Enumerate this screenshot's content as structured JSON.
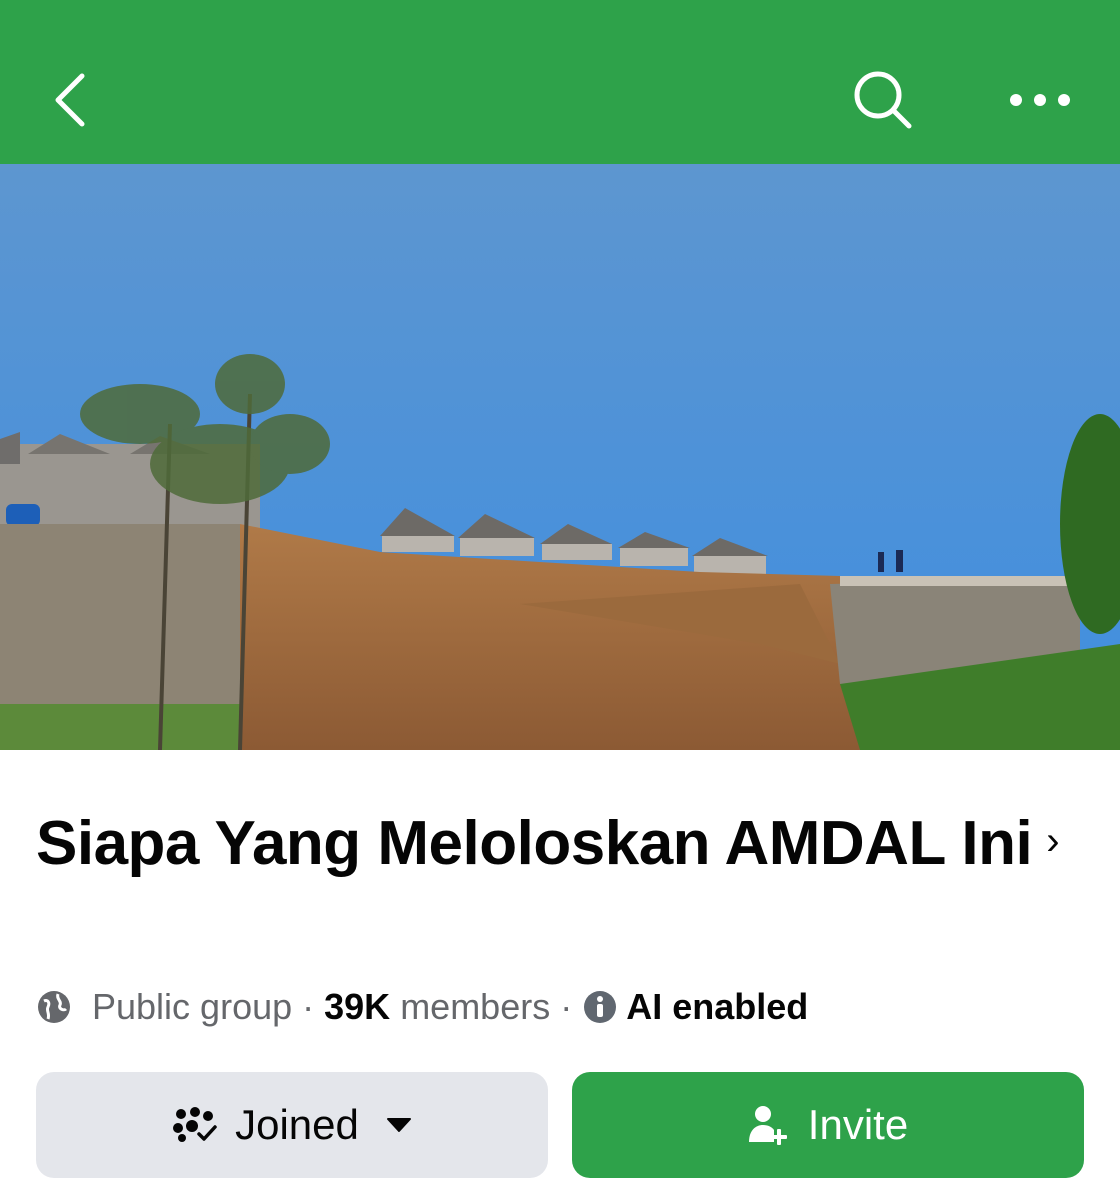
{
  "header": {
    "background_color": "#2ea24a",
    "back_icon": "chevron-left-icon",
    "search_icon": "search-icon",
    "more_icon": "more-horizontal-icon"
  },
  "cover": {
    "image": "landslide-construction-site-photo"
  },
  "group": {
    "name": "Siapa Yang Meloloskan AMDAL Ini",
    "name_chevron": "›",
    "privacy": "Public group",
    "separator": "·",
    "member_count": "39K",
    "member_label": "members",
    "ai_label": "AI enabled"
  },
  "actions": {
    "joined_label": "Joined",
    "invite_label": "Invite",
    "invite_color": "#2ea24a",
    "joined_color": "#e4e6eb"
  }
}
